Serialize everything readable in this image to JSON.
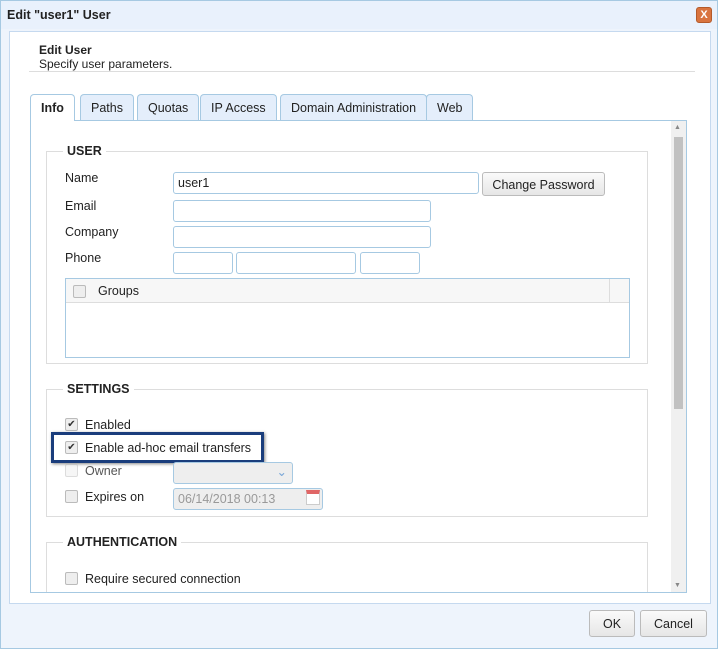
{
  "window": {
    "title": "Edit \"user1\" User",
    "close": "X"
  },
  "header": {
    "title": "Edit User",
    "subtitle": "Specify user parameters."
  },
  "tabs": [
    {
      "label": "Info",
      "active": true
    },
    {
      "label": "Paths"
    },
    {
      "label": "Quotas"
    },
    {
      "label": "IP Access"
    },
    {
      "label": "Domain Administration"
    },
    {
      "label": "Web"
    }
  ],
  "user": {
    "legend": "USER",
    "name_label": "Name",
    "name_value": "user1",
    "change_password": "Change Password",
    "email_label": "Email",
    "company_label": "Company",
    "phone_label": "Phone",
    "groups_header": "Groups"
  },
  "settings": {
    "legend": "SETTINGS",
    "enabled": "Enabled",
    "enabled_checked": true,
    "adhoc": "Enable ad-hoc email transfers",
    "adhoc_checked": true,
    "owner": "Owner",
    "expires": "Expires on",
    "expires_value": "06/14/2018 00:13",
    "highlight_color": "#1a3d7c"
  },
  "auth": {
    "legend": "AUTHENTICATION",
    "secured": "Require secured connection"
  },
  "footer": {
    "ok": "OK",
    "cancel": "Cancel"
  }
}
